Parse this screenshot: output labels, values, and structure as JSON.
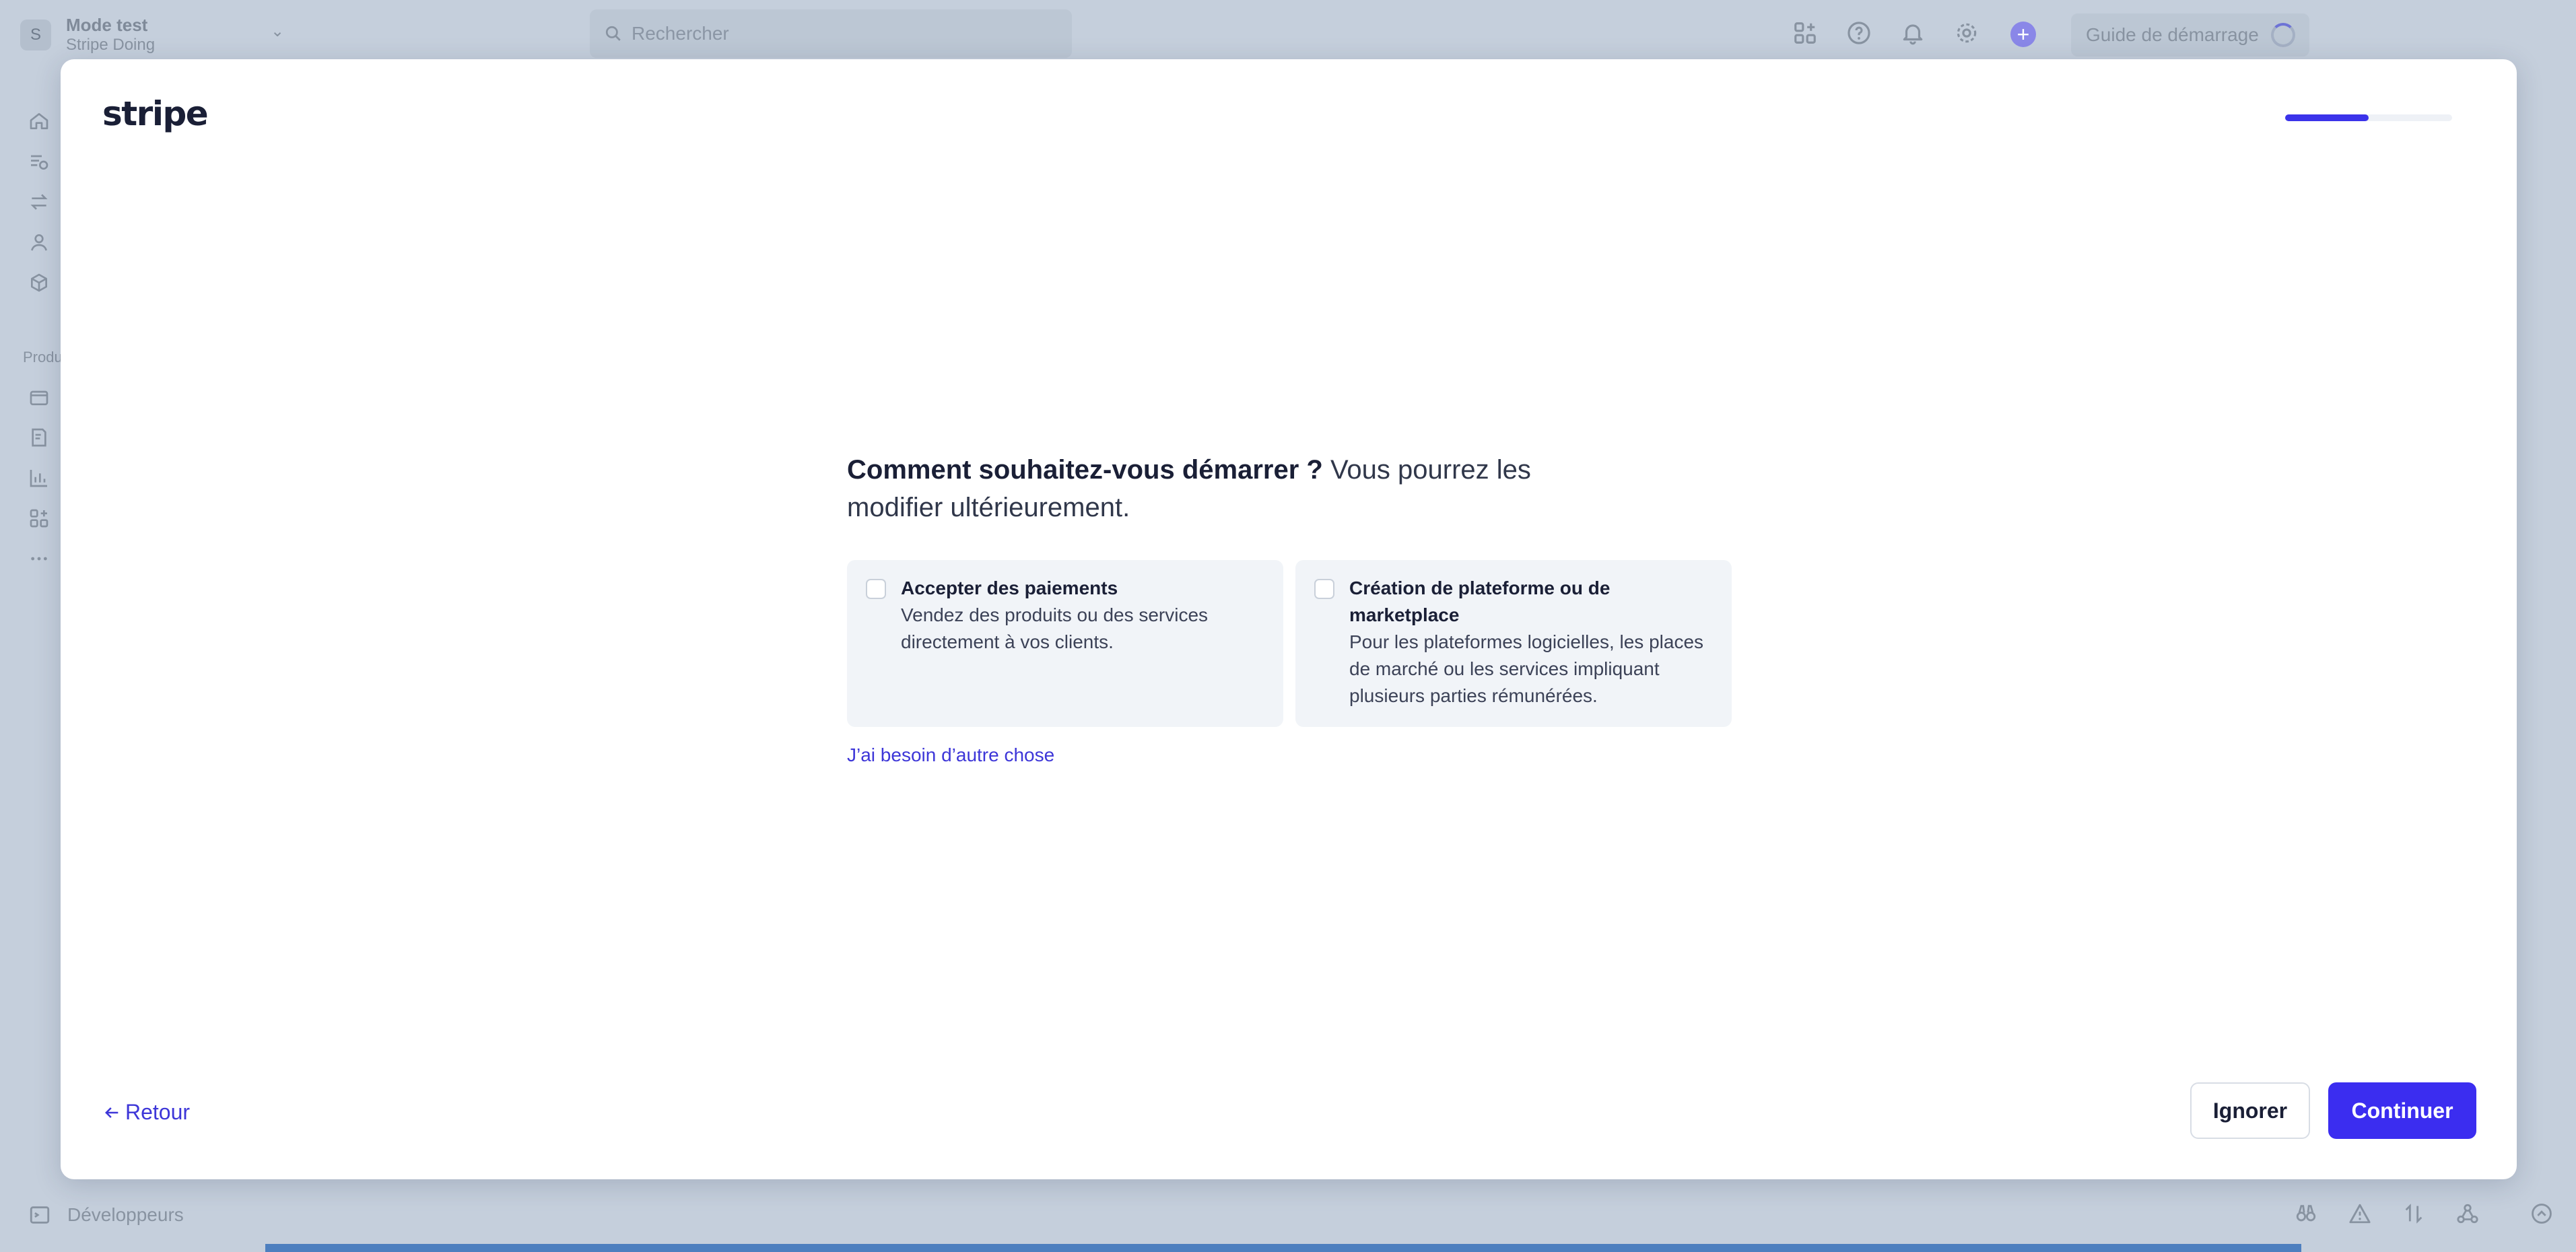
{
  "account": {
    "avatar_letter": "S",
    "mode": "Mode test",
    "name": "Stripe Doing"
  },
  "search": {
    "placeholder": "Rechercher"
  },
  "header": {
    "guide_label": "Guide de démarrage"
  },
  "sidebar": {
    "section_label": "Produi"
  },
  "footer": {
    "developers_label": "Développeurs"
  },
  "modal": {
    "logo": "stripe",
    "progress": 0.5,
    "question_bold": "Comment souhaitez-vous démarrer ?",
    "question_rest": " Vous pourrez les modifier ultérieurement.",
    "options": [
      {
        "title": "Accepter des paiements",
        "description": "Vendez des produits ou des services directement à vos clients."
      },
      {
        "title": "Création de plateforme ou de marketplace",
        "description": "Pour les plateformes logicielles, les places de marché ou les services impliquant plusieurs parties rémunérées."
      }
    ],
    "other_link": "J’ai besoin d’autre chose",
    "back_label": "Retour",
    "ignore_label": "Ignorer",
    "continue_label": "Continuer"
  },
  "colors": {
    "accent": "#3b2df0",
    "link": "#3d36d8",
    "backdrop": "#c5cfdc"
  }
}
